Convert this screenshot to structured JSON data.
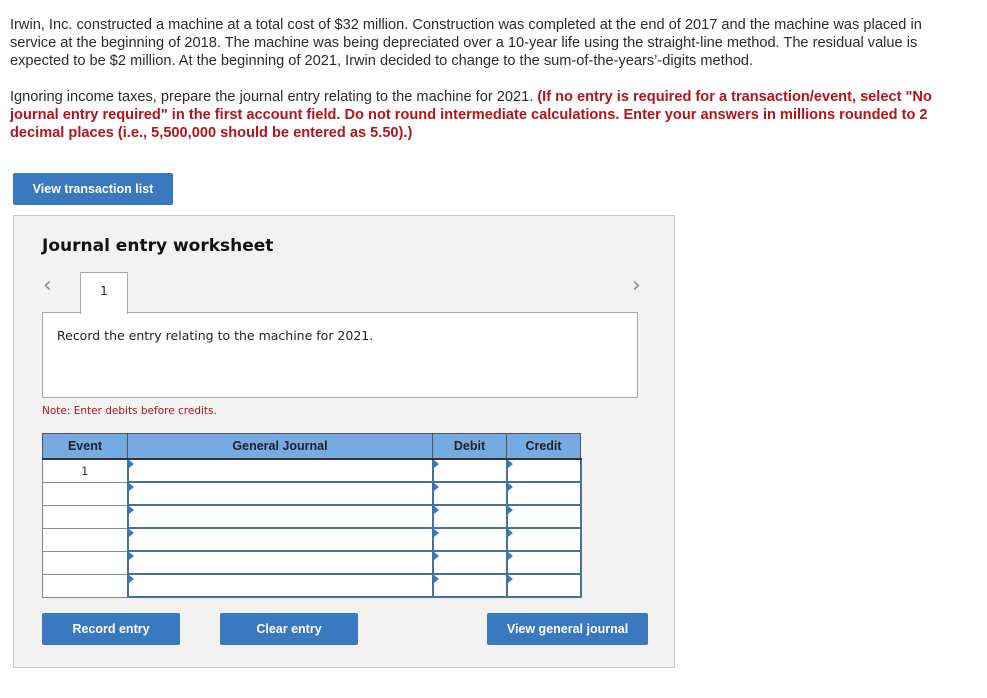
{
  "question": {
    "paragraph1": "Irwin, Inc. constructed a machine at a total cost of $32 million. Construction was completed at the end of 2017 and the machine was placed in service at the beginning of 2018. The machine was being depreciated over a 10-year life using the straight-line method. The residual value is expected to be $2 million. At the beginning of 2021, Irwin decided to change to the sum-of-the-years’-digits method.",
    "paragraph2_plain": "Ignoring income taxes, prepare the journal entry relating to the machine for 2021. ",
    "paragraph2_instructions": "(If no entry is required for a transaction/event, select \"No journal entry required\" in the first account field. Do not round intermediate calculations. Enter your answers in millions rounded to 2 decimal places (i.e., 5,500,000 should be entered as 5.50).)"
  },
  "buttons": {
    "view_transaction_list": "View transaction list",
    "record_entry": "Record entry",
    "clear_entry": "Clear entry",
    "view_general_journal": "View general journal"
  },
  "worksheet": {
    "title": "Journal entry worksheet",
    "nav_prev_icon": "chevron-left",
    "nav_next_icon": "chevron-right",
    "current_tab": "1",
    "prompt": "Record the entry relating to the machine for 2021.",
    "note": "Note: Enter debits before credits."
  },
  "journal_table": {
    "headers": [
      "Event",
      "General Journal",
      "Debit",
      "Credit"
    ],
    "rows": [
      {
        "event": "1",
        "account": "",
        "debit": "",
        "credit": ""
      },
      {
        "event": "",
        "account": "",
        "debit": "",
        "credit": ""
      },
      {
        "event": "",
        "account": "",
        "debit": "",
        "credit": ""
      },
      {
        "event": "",
        "account": "",
        "debit": "",
        "credit": ""
      },
      {
        "event": "",
        "account": "",
        "debit": "",
        "credit": ""
      },
      {
        "event": "",
        "account": "",
        "debit": "",
        "credit": ""
      }
    ]
  },
  "colors": {
    "button_blue": "#3a78bf",
    "header_blue": "#76aae3",
    "instruction_red": "#b3141c",
    "panel_gray": "#f2f2f2"
  }
}
